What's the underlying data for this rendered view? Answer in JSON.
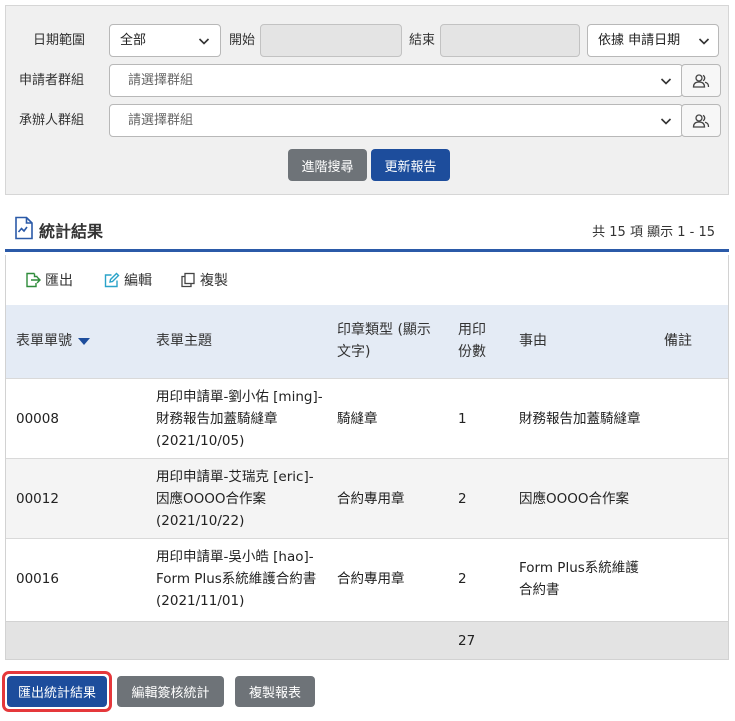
{
  "filters": {
    "date_range_label": "日期範圍",
    "date_range_value": "全部",
    "start_label": "開始",
    "start_value": "",
    "end_label": "結束",
    "end_value": "",
    "date_basis_value": "依據 申請日期",
    "applicant_group_label": "申請者群組",
    "applicant_group_placeholder": "請選擇群組",
    "handler_group_label": "承辦人群組",
    "handler_group_placeholder": "請選擇群組",
    "advanced_search_label": "進階搜尋",
    "update_report_label": "更新報告"
  },
  "results": {
    "title": "統計結果",
    "count_text": "共 15 項 顯示 1 - 15"
  },
  "toolbar": {
    "export_label": "匯出",
    "edit_label": "編輯",
    "copy_label": "複製"
  },
  "table": {
    "headers": {
      "form_no": "表單單號",
      "subject": "表單主題",
      "seal_type_1": "印章類型 (顯示",
      "seal_type_2": "文字)",
      "copies_1": "用印",
      "copies_2": "份數",
      "reason": "事由",
      "note": "備註"
    },
    "rows": [
      {
        "form_no": "00008",
        "subject_1": "用印申請單-劉小佑 [ming]-",
        "subject_2": "財務報告加蓋騎縫章",
        "subject_3": "(2021/10/05)",
        "seal_type": "騎縫章",
        "copies": "1",
        "reason_1": "財務報告加蓋騎縫章",
        "reason_2": "",
        "note": ""
      },
      {
        "form_no": "00012",
        "subject_1": "用印申請單-艾瑞克 [eric]-",
        "subject_2": "因應OOOO合作案",
        "subject_3": "(2021/10/22)",
        "seal_type": "合約專用章",
        "copies": "2",
        "reason_1": "因應OOOO合作案",
        "reason_2": "",
        "note": ""
      },
      {
        "form_no": "00016",
        "subject_1": "用印申請單-吳小皓 [hao]-",
        "subject_2": "Form Plus系統維護合約書",
        "subject_3": "(2021/11/01)",
        "seal_type": "合約專用章",
        "copies": "2",
        "reason_1": "Form Plus系統維護",
        "reason_2": "合約書",
        "note": ""
      }
    ],
    "total_copies": "27"
  },
  "bottom_buttons": {
    "export_stats_label": "匯出統計結果",
    "edit_approval_stats_label": "編輯簽核統計",
    "copy_report_label": "複製報表"
  },
  "colors": {
    "primary_blue": "#1d4d9c",
    "header_blue_bg": "#e4ebf5",
    "gray_button": "#6e7378",
    "focus_red": "#e5383b"
  }
}
